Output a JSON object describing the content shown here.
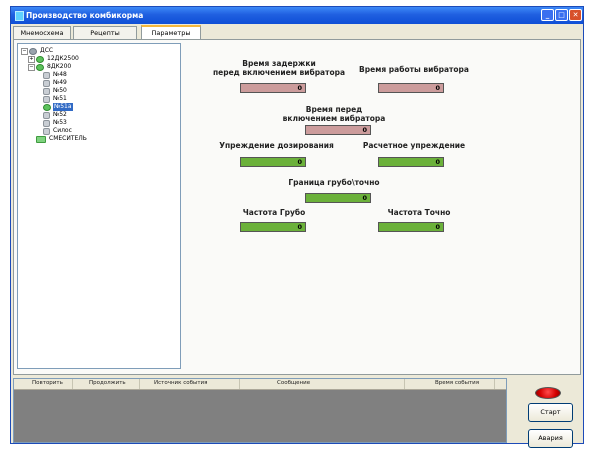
{
  "window": {
    "title": "Производство комбикорма",
    "controls": [
      "minimize",
      "maximize",
      "close"
    ]
  },
  "tabs": [
    {
      "label": "Мнемосхема",
      "active": false
    },
    {
      "label": "Рецепты",
      "active": false
    },
    {
      "label": "Параметры",
      "active": true
    }
  ],
  "tree": {
    "items": [
      {
        "label": "ДСС",
        "icon": "globe-icon",
        "expander": "−"
      },
      {
        "label": "12ДК2500",
        "icon": "green-node-icon",
        "expander": "+"
      },
      {
        "label": "8ДК200",
        "icon": "green-node-icon",
        "expander": "−"
      },
      {
        "label": "№48",
        "icon": "gear-icon"
      },
      {
        "label": "№49",
        "icon": "gear-icon"
      },
      {
        "label": "№50",
        "icon": "gear-icon"
      },
      {
        "label": "№51",
        "icon": "gear-icon"
      },
      {
        "label": "№51а",
        "icon": "green-node-icon",
        "selected": true
      },
      {
        "label": "№52",
        "icon": "gear-icon"
      },
      {
        "label": "№53",
        "icon": "gear-icon"
      },
      {
        "label": "Силос",
        "icon": "gear-icon"
      },
      {
        "label": "СМЕСИТЕЛЬ",
        "icon": "mixer-icon"
      }
    ]
  },
  "params": {
    "delay_before_vibrator": {
      "label_line1": "Время задержки",
      "label_line2": "перед включением вибратора",
      "value": "0"
    },
    "vibrator_work_time": {
      "label": "Время работы вибратора",
      "value": "0"
    },
    "time_before_vibrator": {
      "label_line1": "Время перед",
      "label_line2": "включением вибратора",
      "value": "0"
    },
    "dosing_advance": {
      "label": "Упреждение дозирования",
      "value": "0"
    },
    "calc_advance": {
      "label": "Расчетное упреждение",
      "value": "0"
    },
    "coarse_fine_boundary": {
      "label": "Граница грубо\\точно",
      "value": "0"
    },
    "freq_coarse": {
      "label": "Частота Грубо",
      "value": "0"
    },
    "freq_fine": {
      "label": "Частота Точно",
      "value": "0"
    }
  },
  "colors": {
    "field_pink": "#cc9c9c",
    "field_green": "#6bb13a",
    "led": "#d40000"
  },
  "events": {
    "columns": [
      "Повторить",
      "Продолжить",
      "Источник события",
      "Сообщение",
      "Время события"
    ]
  },
  "buttons": {
    "start": "Старт",
    "emergency": "Авария"
  }
}
